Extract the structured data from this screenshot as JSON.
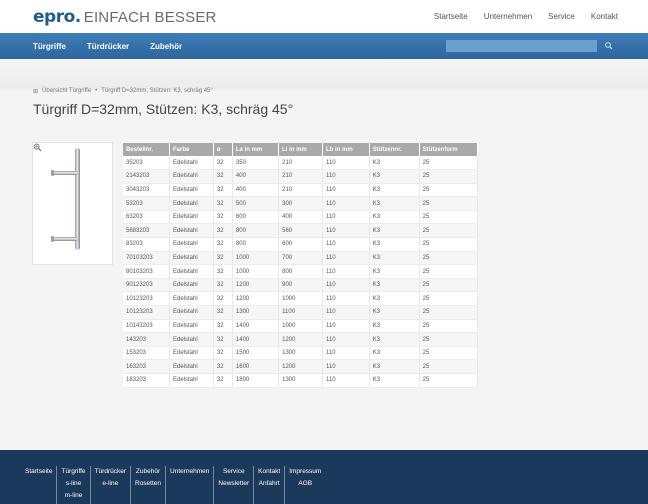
{
  "header": {
    "logo_mark": "epro.",
    "logo_text": "EINFACH BESSER",
    "topnav": [
      "Startseite",
      "Unternehmen",
      "Service",
      "Kontakt"
    ]
  },
  "nav": {
    "items": [
      "Türgriffe",
      "Türdrücker",
      "Zubehör"
    ],
    "search_value": ""
  },
  "breadcrumb": [
    "Übersicht Türgriffe",
    "Türgriff D=32mm, Stützen: K3, schräg 45°"
  ],
  "page_title": "Türgriff D=32mm, Stützen: K3, schräg 45°",
  "table": {
    "headers": [
      "Bestellnr.",
      "Farbe",
      "ø",
      "La in mm",
      "Li in mm",
      "Lb in mm",
      "Stützennr.",
      "Stützenform"
    ],
    "rows": [
      [
        "35203",
        "Edelstahl",
        "32",
        "350",
        "210",
        "110",
        "K3",
        "25"
      ],
      [
        "2143203",
        "Edelstahl",
        "32",
        "400",
        "210",
        "110",
        "K3",
        "25"
      ],
      [
        "3043203",
        "Edelstahl",
        "32",
        "400",
        "210",
        "110",
        "K3",
        "25"
      ],
      [
        "53203",
        "Edelstahl",
        "32",
        "500",
        "300",
        "110",
        "K3",
        "25"
      ],
      [
        "63203",
        "Edelstahl",
        "32",
        "600",
        "400",
        "110",
        "K3",
        "25"
      ],
      [
        "5683203",
        "Edelstahl",
        "32",
        "800",
        "560",
        "110",
        "K3",
        "25"
      ],
      [
        "83203",
        "Edelstahl",
        "32",
        "800",
        "600",
        "110",
        "K3",
        "25"
      ],
      [
        "70103203",
        "Edelstahl",
        "32",
        "1000",
        "700",
        "110",
        "K3",
        "25"
      ],
      [
        "80103203",
        "Edelstahl",
        "32",
        "1000",
        "800",
        "110",
        "K3",
        "25"
      ],
      [
        "90123203",
        "Edelstahl",
        "32",
        "1200",
        "900",
        "110",
        "K3",
        "25"
      ],
      [
        "10123203",
        "Edelstahl",
        "32",
        "1200",
        "1000",
        "110",
        "K3",
        "25"
      ],
      [
        "10123203",
        "Edelstahl",
        "32",
        "1300",
        "1100",
        "110",
        "K3",
        "25"
      ],
      [
        "10143203",
        "Edelstahl",
        "32",
        "1400",
        "1000",
        "110",
        "K3",
        "25"
      ],
      [
        "143203",
        "Edelstahl",
        "32",
        "1400",
        "1200",
        "110",
        "K3",
        "25"
      ],
      [
        "153203",
        "Edelstahl",
        "32",
        "1500",
        "1300",
        "110",
        "K3",
        "25"
      ],
      [
        "163203",
        "Edelstahl",
        "32",
        "1600",
        "1200",
        "110",
        "K3",
        "25"
      ],
      [
        "183203",
        "Edelstahl",
        "32",
        "1800",
        "1300",
        "110",
        "K3",
        "25"
      ]
    ]
  },
  "footer": {
    "columns": [
      [
        "Startseite"
      ],
      [
        "Türgriffe",
        "s-line",
        "m-line",
        "d-line"
      ],
      [
        "Türdrücker",
        "e-line"
      ],
      [
        "Zubehör",
        "Rosetten"
      ],
      [
        "Unternehmen"
      ],
      [
        "Service",
        "Newsletter"
      ],
      [
        "Kontakt",
        "Anfahrt"
      ],
      [
        "Impressum",
        "AGB"
      ]
    ]
  },
  "colors": {
    "brand_blue": "#1f5b8f",
    "nav_blue": "#3f7cb5",
    "footer_navy": "#1b3a5b",
    "table_header_gray": "#a9a9a9"
  },
  "icons": [
    "search-icon",
    "zoom-icon",
    "breadcrumb-bullet-icon"
  ]
}
